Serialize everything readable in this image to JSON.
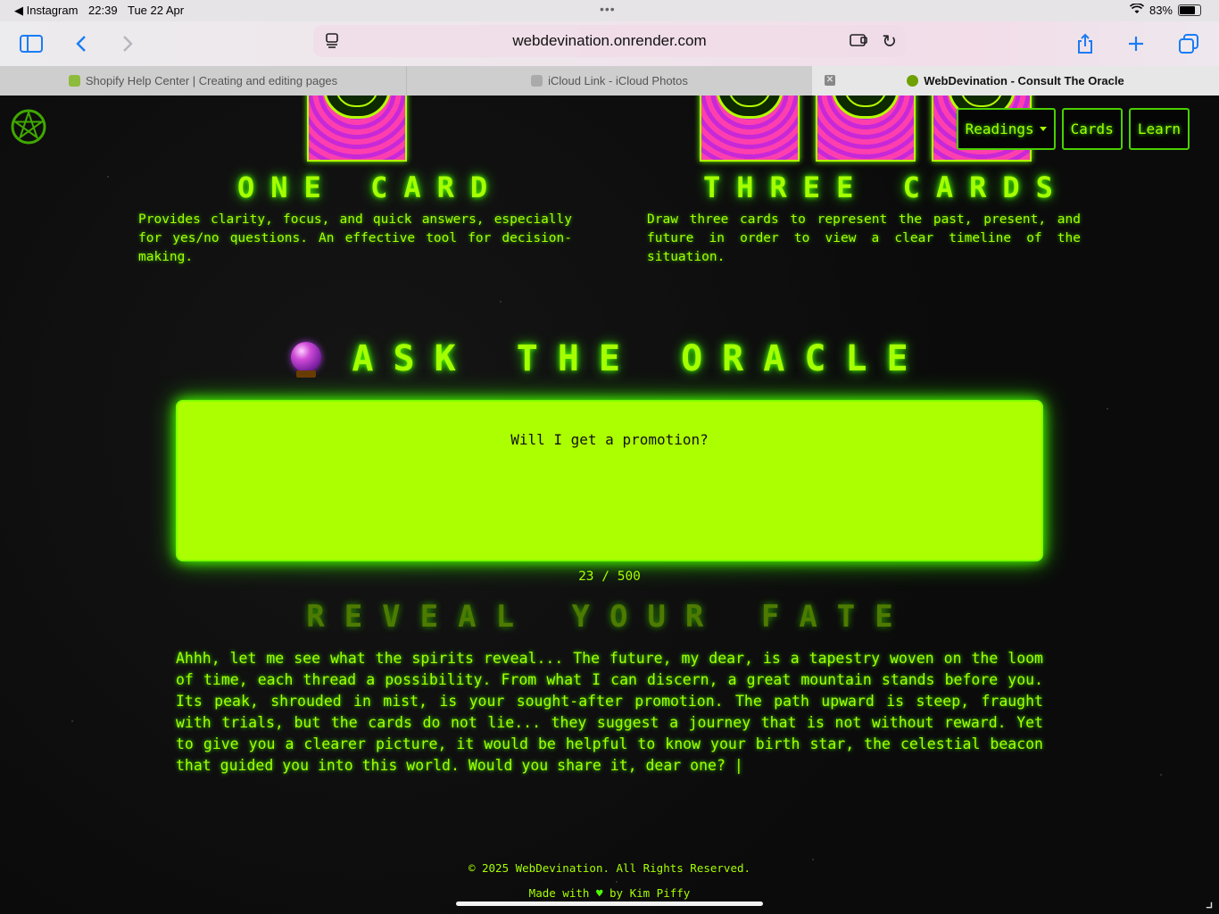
{
  "status_bar": {
    "back_app": "◀ Instagram",
    "time": "22:39",
    "date": "Tue 22 Apr",
    "battery": "83%",
    "battery_level": 0.83
  },
  "browser": {
    "url": "webdevination.onrender.com",
    "tabs": [
      {
        "title": "Shopify Help Center | Creating and editing pages",
        "favicon_color": "#8dbb3b"
      },
      {
        "title": "iCloud Link - iCloud Photos",
        "favicon_color": "#aaaaaa"
      },
      {
        "title": "WebDevination - Consult The Oracle",
        "favicon_color": "#6ea000"
      }
    ],
    "active_tab": 2
  },
  "nav": {
    "readings": "Readings",
    "cards": "Cards",
    "learn": "Learn"
  },
  "spreads": {
    "one": {
      "title": "ONE CARD",
      "description": "Provides clarity, focus, and quick answers, especially for yes/no questions. An effective tool for decision-making."
    },
    "three": {
      "title": "THREE CARDS",
      "description": "Draw three cards to represent the past, present, and future in order to view a clear timeline of the situation."
    }
  },
  "oracle": {
    "title": "ASK THE ORACLE",
    "question": "Will I get a promotion?",
    "counter": "23 / 500",
    "reveal_title": "REVEAL YOUR FATE",
    "answer": "Ahhh, let me see what the spirits reveal... The future, my dear, is a tapestry woven on the loom of time, each thread a possibility. From what I can discern, a great mountain stands before you. Its peak, shrouded in mist, is your sought-after promotion. The path upward is steep, fraught with trials, but the cards do not lie... they suggest a journey that is not without reward. Yet to give you a clearer picture, it would be helpful to know your birth star, the celestial beacon that guided you into this world. Would you share it, dear one? |"
  },
  "footer": {
    "copyright": "© 2025 WebDevination. All Rights Reserved.",
    "made_with_prefix": "Made with",
    "made_with_suffix": "by Kim Piffy"
  },
  "colors": {
    "neon": "#a6ff00",
    "background": "#0b0b0b",
    "input_bg": "#acff00"
  }
}
